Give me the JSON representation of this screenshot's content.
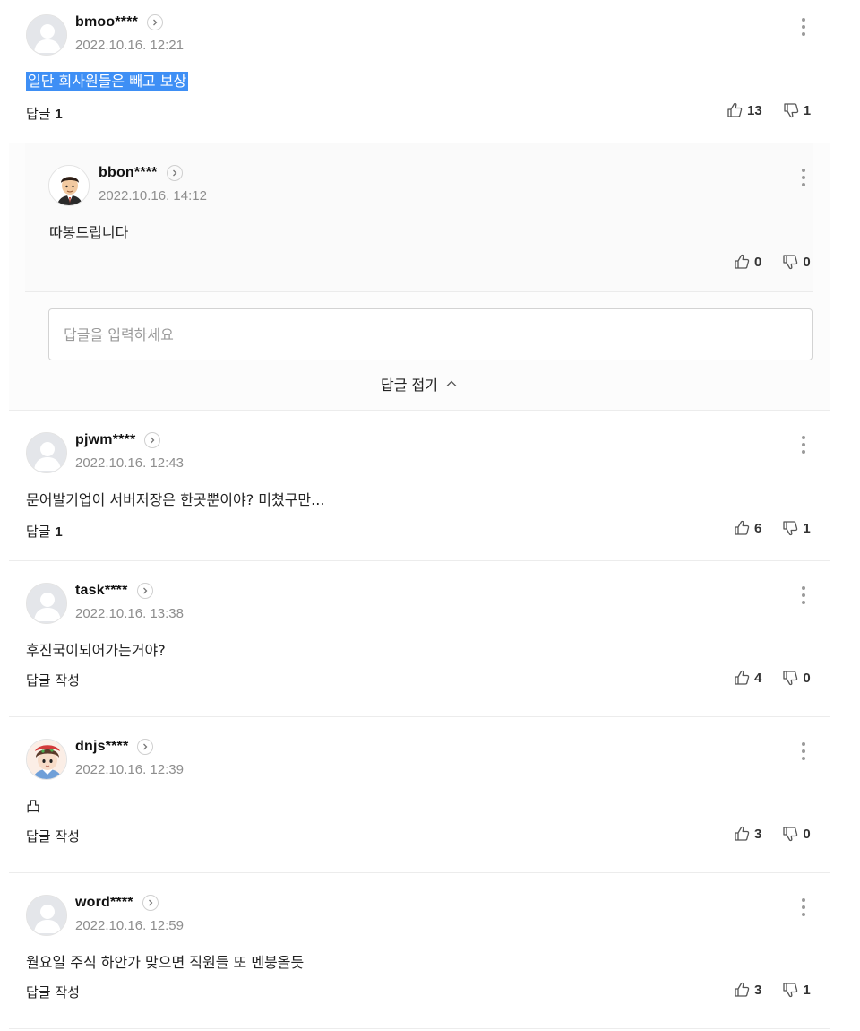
{
  "comments": [
    {
      "nickname": "bmoo****",
      "date": "2022.10.16. 12:21",
      "text": "일단 회사원들은 빼고 보상",
      "reply_label": "답글",
      "reply_count": "1",
      "likes": "13",
      "dislikes": "1",
      "avatar": "default-avatar",
      "replies": [
        {
          "nickname": "bbon****",
          "date": "2022.10.16. 14:12",
          "text": "따봉드립니다",
          "likes": "0",
          "dislikes": "0",
          "avatar": "man-cartoon-avatar"
        }
      ],
      "reply_input_placeholder": "답글을 입력하세요",
      "fold_label": "답글 접기"
    },
    {
      "nickname": "pjwm****",
      "date": "2022.10.16. 12:43",
      "text": "문어발기업이 서버저장은 한곳뿐이야? 미쳤구만...",
      "reply_label": "답글",
      "reply_count": "1",
      "likes": "6",
      "dislikes": "1",
      "avatar": "default-avatar"
    },
    {
      "nickname": "task****",
      "date": "2022.10.16. 13:38",
      "text": "후진국이되어가는거야?",
      "reply_label": "답글 작성",
      "likes": "4",
      "dislikes": "0",
      "avatar": "default-avatar"
    },
    {
      "nickname": "dnjs****",
      "date": "2022.10.16. 12:39",
      "text": "凸",
      "reply_label": "답글 작성",
      "likes": "3",
      "dislikes": "0",
      "avatar": "boy-cartoon-avatar"
    },
    {
      "nickname": "word****",
      "date": "2022.10.16. 12:59",
      "text": "월요일 주식 하안가 맞으면 직원들 또 멘붕올듯",
      "reply_label": "답글 작성",
      "likes": "3",
      "dislikes": "1",
      "avatar": "default-avatar"
    }
  ],
  "colors": {
    "highlight": "#3e8ff5",
    "date": "#8e8e8e",
    "border": "#ececec"
  }
}
